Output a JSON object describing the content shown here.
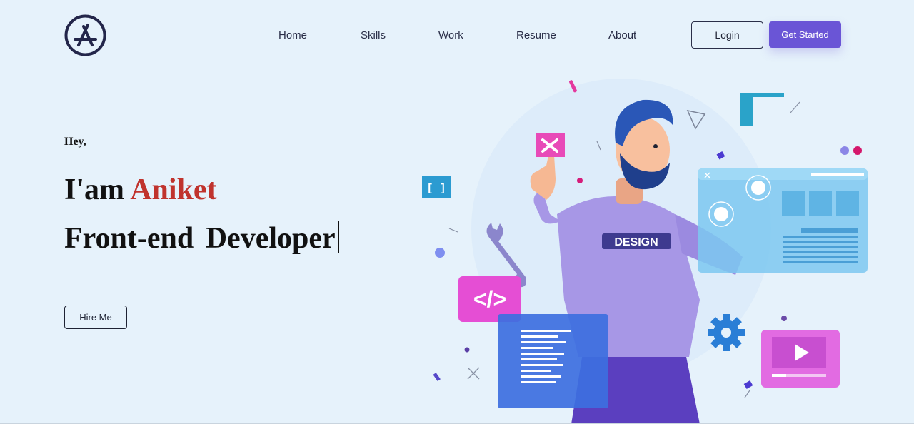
{
  "nav": {
    "links": [
      {
        "label": "Home"
      },
      {
        "label": "Skills"
      },
      {
        "label": "Work"
      },
      {
        "label": "Resume"
      },
      {
        "label": "About"
      }
    ],
    "login_label": "Login",
    "get_started_label": "Get Started"
  },
  "hero": {
    "greeting": "Hey,",
    "intro_prefix": "I'am",
    "name": "Aniket",
    "role": "Front-end Developer",
    "hire_label": "Hire Me"
  },
  "illustration": {
    "shirt_text": "DESIGN",
    "code_tag_text": "</>",
    "bracket_text": "[ ]"
  },
  "colors": {
    "background": "#e6f2fb",
    "accent": "#6a55d6",
    "name_highlight": "#c0332d",
    "text_dark": "#111111"
  },
  "icons": {
    "logo": "app-store-a-logo-icon",
    "close": "close-icon",
    "code": "code-icon",
    "wrench": "wrench-icon",
    "gear": "gear-icon",
    "play": "play-icon"
  }
}
